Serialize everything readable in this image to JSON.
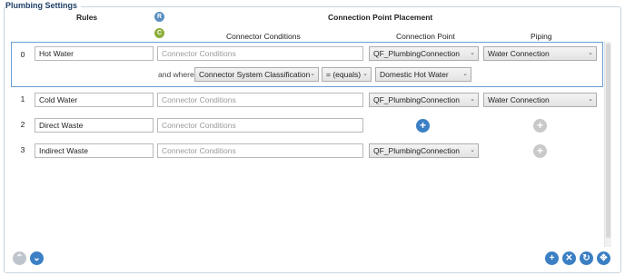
{
  "group_title": "Plumbing Settings",
  "headers": {
    "rules": "Rules",
    "placement": "Connection Point Placement",
    "conditions": "Connector Conditions",
    "connection_point": "Connection Point",
    "piping": "Piping"
  },
  "badges": {
    "r": "R",
    "c": "C"
  },
  "colors": {
    "accent": "#3b7fc4",
    "badge_r": "#5b8fc0",
    "badge_c": "#8dae3a",
    "selection": "#6a9fd4"
  },
  "rows": [
    {
      "index": "0",
      "rule": "Hot Water",
      "conditions_placeholder": "Connector Conditions",
      "connection_point": "QF_PlumbingConnection",
      "piping": "Water Connection",
      "where_label": "and where",
      "where_property": "Connector System Classification",
      "where_operator": "= (equals)",
      "where_value": "Domestic Hot Water"
    },
    {
      "index": "1",
      "rule": "Cold Water",
      "conditions_placeholder": "Connector Conditions",
      "connection_point": "QF_PlumbingConnection",
      "piping": "Water Connection"
    },
    {
      "index": "2",
      "rule": "Direct Waste",
      "conditions_placeholder": "Connector Conditions"
    },
    {
      "index": "3",
      "rule": "Indirect Waste",
      "conditions_placeholder": "Connector Conditions",
      "connection_point": "QF_PlumbingConnection"
    }
  ],
  "icons": {
    "chevron": "chevron-down-icon",
    "add": "plus-icon",
    "move_up": "arrow-up-icon",
    "move_down": "arrow-down-icon",
    "remove": "close-icon",
    "refresh": "refresh-icon",
    "expand": "expand-icon"
  },
  "glyphs": {
    "chevron": "⌄",
    "plus": "+",
    "up": "⌃",
    "down": "⌄",
    "close": "✕",
    "refresh": "↻",
    "expand": "✥"
  }
}
